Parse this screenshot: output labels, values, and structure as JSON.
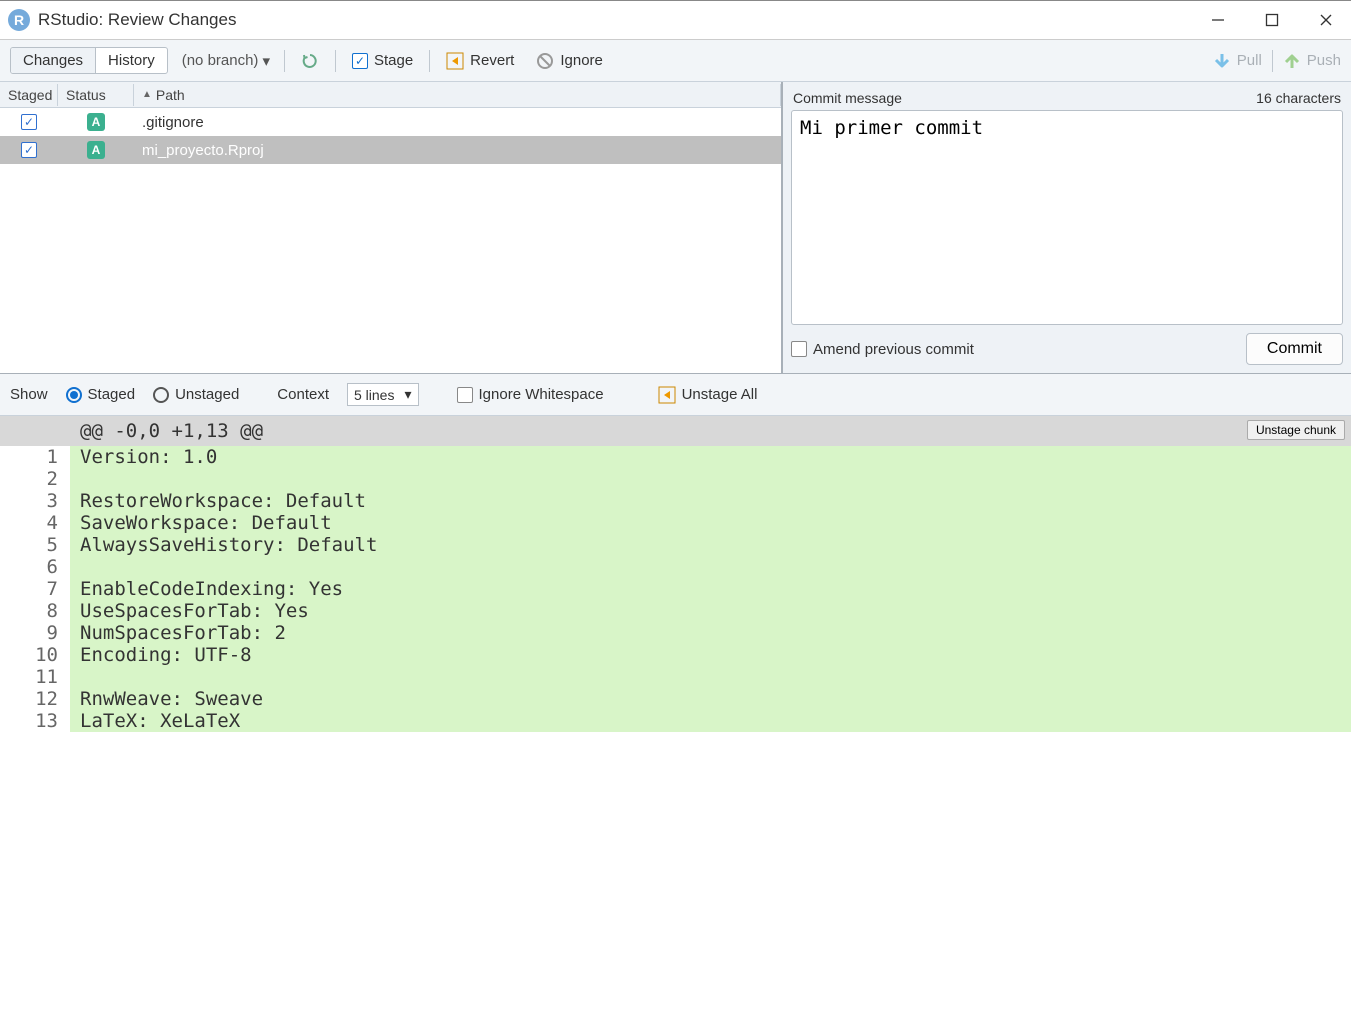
{
  "titlebar": {
    "app_letter": "R",
    "title": "RStudio: Review Changes"
  },
  "toolbar": {
    "tabs": {
      "changes": "Changes",
      "history": "History"
    },
    "branch": "(no branch)",
    "stage": "Stage",
    "revert": "Revert",
    "ignore": "Ignore",
    "pull": "Pull",
    "push": "Push"
  },
  "filelist": {
    "headers": {
      "staged": "Staged",
      "status": "Status",
      "path": "Path"
    },
    "rows": [
      {
        "staged": true,
        "status": "A",
        "path": ".gitignore",
        "selected": false
      },
      {
        "staged": true,
        "status": "A",
        "path": "mi_proyecto.Rproj",
        "selected": true
      }
    ]
  },
  "commit": {
    "label": "Commit message",
    "char_count": "16 characters",
    "message": "Mi primer commit",
    "amend": "Amend previous commit",
    "button": "Commit"
  },
  "difftoolbar": {
    "show": "Show",
    "staged": "Staged",
    "unstaged": "Unstaged",
    "context": "Context",
    "context_value": "5 lines",
    "ignore_ws": "Ignore Whitespace",
    "unstage_all": "Unstage All"
  },
  "hunk": {
    "header": "@@ -0,0 +1,13 @@",
    "unstage_chunk": "Unstage chunk",
    "lines": [
      {
        "n": "1",
        "t": "Version: 1.0"
      },
      {
        "n": "2",
        "t": ""
      },
      {
        "n": "3",
        "t": "RestoreWorkspace: Default"
      },
      {
        "n": "4",
        "t": "SaveWorkspace: Default"
      },
      {
        "n": "5",
        "t": "AlwaysSaveHistory: Default"
      },
      {
        "n": "6",
        "t": ""
      },
      {
        "n": "7",
        "t": "EnableCodeIndexing: Yes"
      },
      {
        "n": "8",
        "t": "UseSpacesForTab: Yes"
      },
      {
        "n": "9",
        "t": "NumSpacesForTab: 2"
      },
      {
        "n": "10",
        "t": "Encoding: UTF-8"
      },
      {
        "n": "11",
        "t": ""
      },
      {
        "n": "12",
        "t": "RnwWeave: Sweave"
      },
      {
        "n": "13",
        "t": "LaTeX: XeLaTeX"
      }
    ]
  }
}
